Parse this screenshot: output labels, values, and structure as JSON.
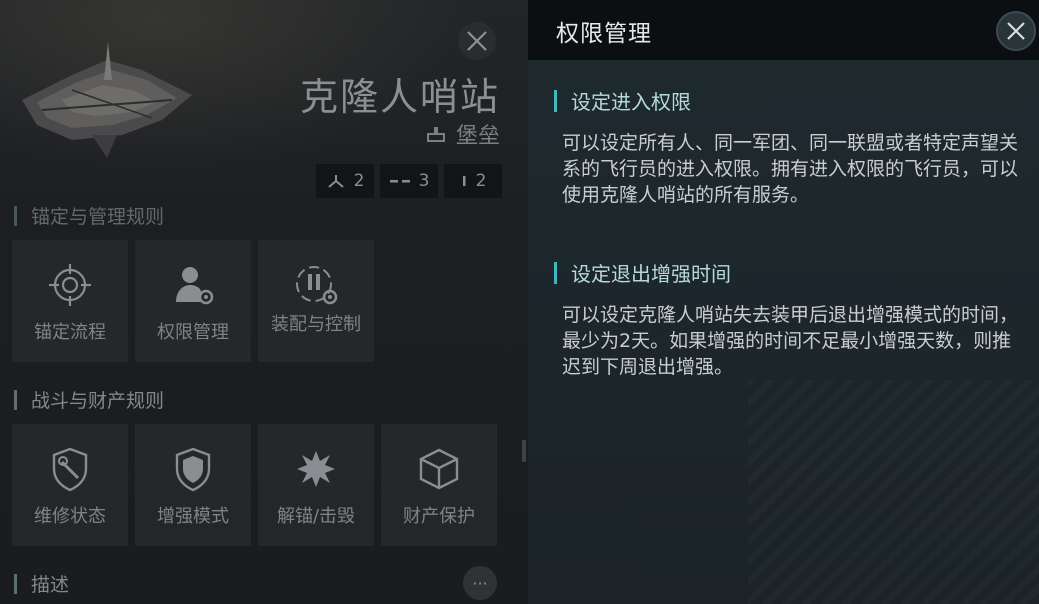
{
  "left_panel": {
    "station_name": "克隆人哨站",
    "station_type": "堡垒",
    "stats": [
      {
        "icon": "fighter-icon",
        "value": "2"
      },
      {
        "icon": "dash-icon",
        "value": "3"
      },
      {
        "icon": "line-icon",
        "value": "2"
      }
    ],
    "section_anchor": "锚定与管理规则",
    "anchor_tiles": [
      {
        "label": "锚定流程",
        "icon": "crosshair-icon"
      },
      {
        "label": "权限管理",
        "icon": "user-gear-icon"
      },
      {
        "label": "装配与控制",
        "icon": "fitting-gear-icon"
      }
    ],
    "section_combat": "战斗与财产规则",
    "combat_tiles": [
      {
        "label": "维修状态",
        "icon": "repair-shield-icon"
      },
      {
        "label": "增强模式",
        "icon": "shield-icon"
      },
      {
        "label": "解锚/击毁",
        "icon": "explosion-icon"
      },
      {
        "label": "财产保护",
        "icon": "cube-icon"
      }
    ],
    "section_desc": "描述",
    "more_label": "···"
  },
  "right_panel": {
    "title": "权限管理",
    "sections": [
      {
        "heading": "设定进入权限",
        "body": "可以设定所有人、同一军团、同一联盟或者特定声望关系的飞行员的进入权限。拥有进入权限的飞行员，可以使用克隆人哨站的所有服务。"
      },
      {
        "heading": "设定退出增强时间",
        "body": "可以设定克隆人哨站失去装甲后退出增强模式的时间，最少为2天。如果增强的时间不足最小增强天数，则推迟到下周退出增强。"
      }
    ]
  },
  "colors": {
    "accent": "#3fb9b9",
    "panel_left": "#1c1e21",
    "panel_right": "#1f2a2f",
    "header_dark": "#0b0f11"
  }
}
